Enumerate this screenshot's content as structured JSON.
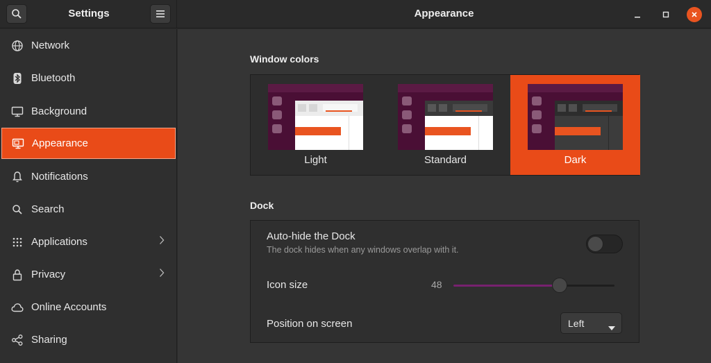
{
  "header": {
    "left_title": "Settings",
    "right_title": "Appearance",
    "search_icon": "search-icon",
    "menu_icon": "hamburger-icon"
  },
  "sidebar": {
    "items": [
      {
        "label": "Network",
        "icon": "network-icon"
      },
      {
        "label": "Bluetooth",
        "icon": "bluetooth-icon"
      },
      {
        "label": "Background",
        "icon": "display-icon"
      },
      {
        "label": "Appearance",
        "icon": "appearance-icon",
        "active": true
      },
      {
        "label": "Notifications",
        "icon": "bell-icon"
      },
      {
        "label": "Search",
        "icon": "search-icon"
      },
      {
        "label": "Applications",
        "icon": "apps-grid-icon",
        "has_submenu": true
      },
      {
        "label": "Privacy",
        "icon": "lock-icon",
        "has_submenu": true
      },
      {
        "label": "Online Accounts",
        "icon": "cloud-icon"
      },
      {
        "label": "Sharing",
        "icon": "share-icon"
      }
    ]
  },
  "window_colors": {
    "title": "Window colors",
    "options": [
      {
        "label": "Light"
      },
      {
        "label": "Standard"
      },
      {
        "label": "Dark",
        "selected": true
      }
    ]
  },
  "dock": {
    "title": "Dock",
    "autohide_label": "Auto-hide the Dock",
    "autohide_desc": "The dock hides when any windows overlap with it.",
    "autohide_on": false,
    "icon_size_label": "Icon size",
    "icon_size_value": "48",
    "icon_size_fraction": 0.66,
    "position_label": "Position on screen",
    "position_value": "Left"
  },
  "colors": {
    "accent": "#e95420",
    "slider_fill": "#77216f"
  }
}
